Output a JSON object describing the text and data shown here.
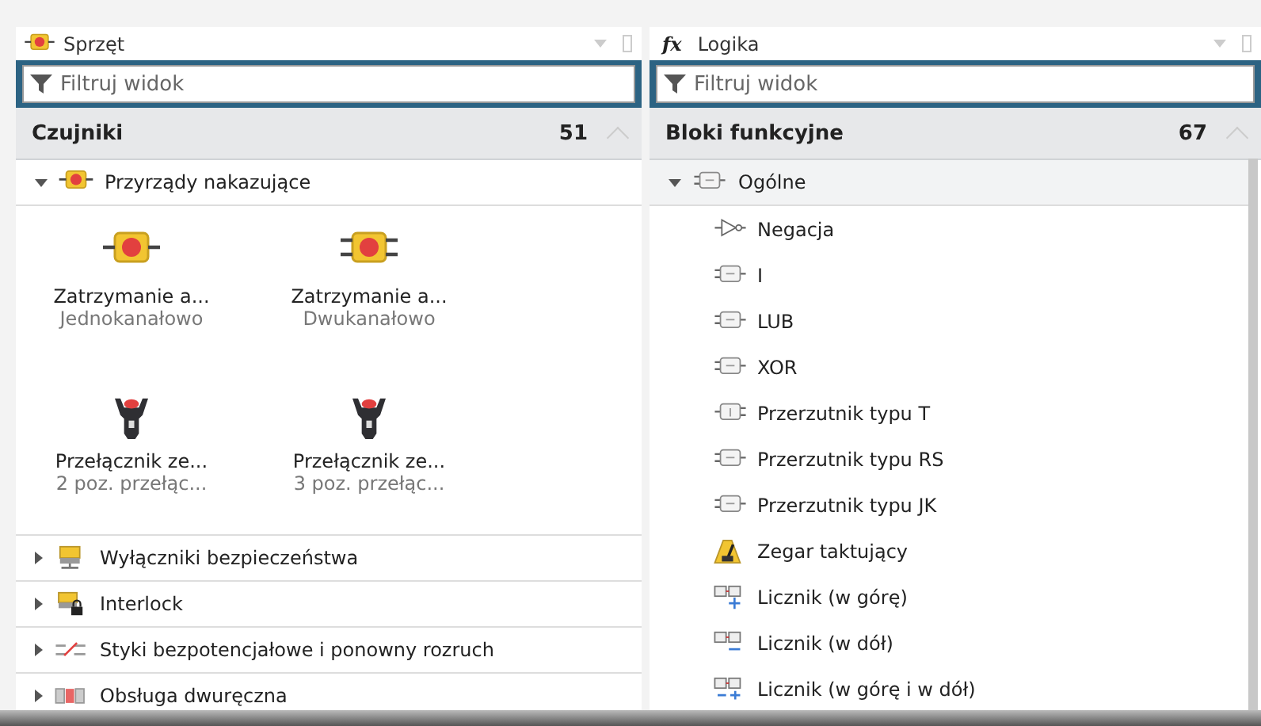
{
  "panels": [
    {
      "title": "Sprzęt",
      "title_icon": {
        "kind": "estop"
      },
      "filter": {
        "placeholder": "Filtruj widok"
      },
      "group": {
        "label": "Czujniki",
        "count": "51",
        "expanded": true
      },
      "items": [
        {
          "label": "Przyrządy nakazujące",
          "kind": "estop",
          "expanded": true,
          "tiles": [
            {
              "name": "Zatrzymanie a...",
              "sub": "Jednokanałowo",
              "kind": "estop"
            },
            {
              "name": "Zatrzymanie a...",
              "sub": "Dwukanałowo",
              "kind": "estop2"
            },
            {
              "name": "Przełącznik ze...",
              "sub": "2 poz. przełąc...",
              "kind": "switch"
            },
            {
              "name": "Przełącznik ze...",
              "sub": "3 poz. przełąc...",
              "kind": "switch"
            }
          ]
        },
        {
          "label": "Wyłączniki bezpieczeństwa",
          "kind": "safety",
          "expanded": false
        },
        {
          "label": "Interlock",
          "kind": "lock",
          "expanded": false
        },
        {
          "label": "Styki bezpotencjałowe i ponowny rozruch",
          "kind": "contacts",
          "expanded": false
        },
        {
          "label": "Obsługa dwuręczna",
          "kind": "twohand",
          "expanded": false
        }
      ]
    },
    {
      "title": "Logika",
      "title_icon": {
        "kind": "text",
        "text": "fx"
      },
      "filter": {
        "placeholder": "Filtruj widok"
      },
      "group": {
        "label": "Bloki funkcyjne",
        "count": "67",
        "expanded": true
      },
      "items": [
        {
          "label": "Ogólne",
          "kind": "gate",
          "expanded": true,
          "children": [
            {
              "label": "Negacja",
              "kind": "not"
            },
            {
              "label": "I",
              "kind": "gate"
            },
            {
              "label": "LUB",
              "kind": "gate"
            },
            {
              "label": "XOR",
              "kind": "gate"
            },
            {
              "label": "Przerzutnik typu T",
              "kind": "gate_rev"
            },
            {
              "label": "Przerzutnik typu RS",
              "kind": "gate"
            },
            {
              "label": "Przerzutnik typu JK",
              "kind": "gate"
            },
            {
              "label": "Zegar taktujący",
              "kind": "metronome"
            },
            {
              "label": "Licznik (w górę)",
              "kind": "counter_up"
            },
            {
              "label": "Licznik (w dół)",
              "kind": "counter_down"
            },
            {
              "label": "Licznik (w górę i w dół)",
              "kind": "counter_both"
            }
          ]
        }
      ]
    }
  ]
}
